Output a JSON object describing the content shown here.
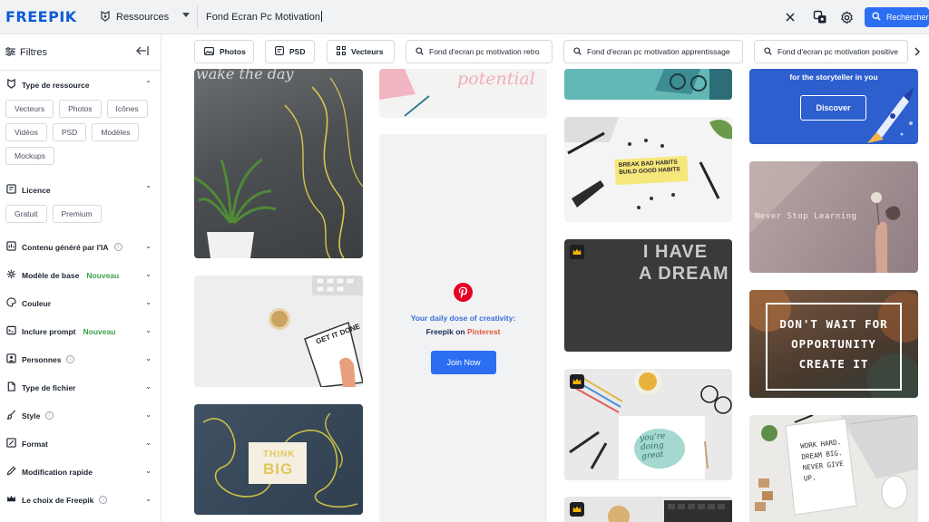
{
  "header": {
    "logo": "FREEPIK",
    "resource_select": "Ressources",
    "search_value": "Fond Ecran Pc Motivation",
    "search_button": "Rechercher"
  },
  "sidebar": {
    "title": "Filtres",
    "resource_type": {
      "title": "Type de ressource",
      "chips": [
        "Vecteurs",
        "Photos",
        "Icônes",
        "Vidéos",
        "PSD",
        "Modèles",
        "Mockups"
      ]
    },
    "licence": {
      "title": "Licence",
      "chips": [
        "Gratuit",
        "Premium"
      ]
    },
    "sections": [
      {
        "label": "Contenu généré par l'IA",
        "badge": "",
        "info": true,
        "icon": "ai-icon"
      },
      {
        "label": "Modèle de base",
        "badge": "Nouveau",
        "info": false,
        "icon": "cube-icon"
      },
      {
        "label": "Couleur",
        "badge": "",
        "info": false,
        "icon": "palette-icon"
      },
      {
        "label": "Inclure prompt",
        "badge": "Nouveau",
        "info": false,
        "icon": "prompt-icon"
      },
      {
        "label": "Personnes",
        "badge": "",
        "info": true,
        "icon": "person-icon"
      },
      {
        "label": "Type de fichier",
        "badge": "",
        "info": false,
        "icon": "file-icon"
      },
      {
        "label": "Style",
        "badge": "",
        "info": true,
        "icon": "brush-icon"
      },
      {
        "label": "Format",
        "badge": "",
        "info": false,
        "icon": "format-icon"
      },
      {
        "label": "Modification rapide",
        "badge": "",
        "info": false,
        "icon": "edit-icon"
      },
      {
        "label": "Le choix de Freepik",
        "badge": "",
        "info": true,
        "icon": "crown-icon"
      }
    ],
    "info_glyph": "i"
  },
  "pills": [
    "Photos",
    "PSD",
    "Vecteurs",
    "Fond d'ecran pc motivation retro",
    "Fond d'ecran pc motivation apprentissage",
    "Fond d'ecran pc motivation positive"
  ],
  "tiles": {
    "potential": "potential",
    "wall_neon": "wake the day",
    "promo_line1": "Your daily dose of creativity:",
    "promo_brand": "Freepik",
    "promo_on": "on",
    "promo_network": "Pinterest",
    "promo_button": "Join Now",
    "habits_note": "BREAK BAD HABITS BUILD GOOD HABITS",
    "dream_line1": "I HAVE",
    "dream_line2": "A DREAM",
    "think_line1": "THINK",
    "think_line2": "BIG",
    "get_it_done": "GET IT DONE",
    "never_stop": "Never Stop Learning",
    "storyteller": "for the storyteller in you",
    "discover": "Discover",
    "dont_wait_1": "DON'T WAIT FOR",
    "dont_wait_2": "OPPORTUNITY",
    "dont_wait_3": "CREATE IT",
    "doing_great": "you're doing great",
    "work_hard": "WORK HARD. DREAM BIG. NEVER GIVE UP."
  },
  "colors": {
    "brand_blue": "#2c6ef2",
    "logo_blue": "#0e5bd6",
    "new_green": "#3aa34a",
    "pinterest_red": "#e60023",
    "promo_text_blue": "#3a6fd8"
  }
}
